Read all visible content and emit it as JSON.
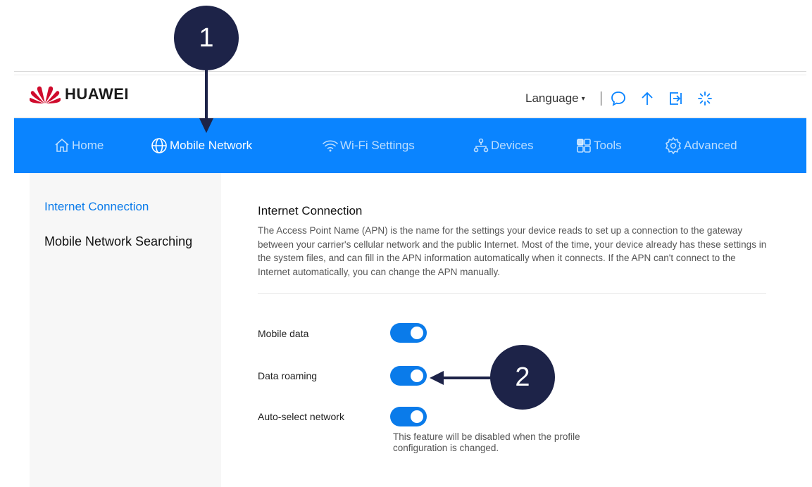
{
  "brand": {
    "name": "HUAWEI",
    "logo_color": "#cf0a2c"
  },
  "header": {
    "language_label": "Language",
    "icons": [
      "message-icon",
      "upload-arrow-icon",
      "logout-icon",
      "loading-icon"
    ]
  },
  "nav": {
    "items": [
      {
        "label": "Home",
        "icon": "home-icon"
      },
      {
        "label": "Mobile Network",
        "icon": "globe-icon",
        "active": true
      },
      {
        "label": "Wi-Fi Settings",
        "icon": "wifi-icon"
      },
      {
        "label": "Devices",
        "icon": "devices-icon"
      },
      {
        "label": "Tools",
        "icon": "tools-icon"
      },
      {
        "label": "Advanced",
        "icon": "gear-icon"
      }
    ],
    "bg_color": "#0a84ff"
  },
  "sidebar": {
    "items": [
      {
        "label": "Internet Connection",
        "active": true
      },
      {
        "label": "Mobile Network Searching"
      }
    ]
  },
  "main": {
    "title": "Internet Connection",
    "description": "The Access Point Name (APN) is the name for the settings your device reads to set up a connection to the gateway between your carrier's cellular network and the public Internet. Most of the time, your device already has these settings in the system files, and can fill in the APN information automatically when it connects. If the APN can't connect to the Internet automatically, you can change the APN manually.",
    "settings": [
      {
        "label": "Mobile data",
        "enabled": true
      },
      {
        "label": "Data roaming",
        "enabled": true
      },
      {
        "label": "Auto-select network",
        "enabled": true
      }
    ],
    "auto_select_note": "This feature will be disabled when the profile configuration is changed.",
    "toggle_color": "#0a7bea"
  },
  "annotations": {
    "callout_1": "1",
    "callout_2": "2",
    "color": "#1d2348"
  }
}
